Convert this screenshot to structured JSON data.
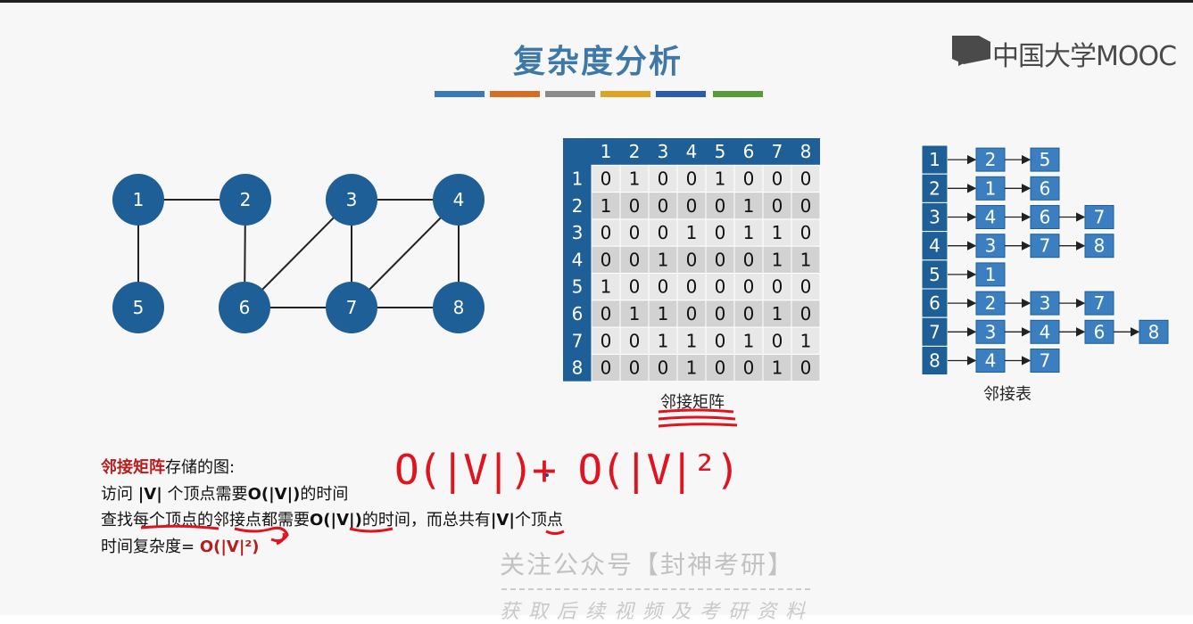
{
  "title": "复杂度分析",
  "logo": {
    "text": "中国大学MOOC"
  },
  "title_bar_colors": [
    "#3e7ab2",
    "#d36f25",
    "#8b8b8b",
    "#dca324",
    "#2e5ba8",
    "#5a9a3d"
  ],
  "graph": {
    "nodes": [
      "1",
      "2",
      "3",
      "4",
      "5",
      "6",
      "7",
      "8"
    ],
    "edges": [
      [
        "1",
        "2"
      ],
      [
        "1",
        "5"
      ],
      [
        "2",
        "6"
      ],
      [
        "3",
        "4"
      ],
      [
        "3",
        "6"
      ],
      [
        "3",
        "7"
      ],
      [
        "4",
        "7"
      ],
      [
        "4",
        "8"
      ],
      [
        "6",
        "7"
      ],
      [
        "7",
        "8"
      ]
    ]
  },
  "matrix": {
    "headers": [
      "1",
      "2",
      "3",
      "4",
      "5",
      "6",
      "7",
      "8"
    ],
    "rows": [
      [
        0,
        1,
        0,
        0,
        1,
        0,
        0,
        0
      ],
      [
        1,
        0,
        0,
        0,
        0,
        1,
        0,
        0
      ],
      [
        0,
        0,
        0,
        1,
        0,
        1,
        1,
        0
      ],
      [
        0,
        0,
        1,
        0,
        0,
        0,
        1,
        1
      ],
      [
        1,
        0,
        0,
        0,
        0,
        0,
        0,
        0
      ],
      [
        0,
        1,
        1,
        0,
        0,
        0,
        1,
        0
      ],
      [
        0,
        0,
        1,
        1,
        0,
        1,
        0,
        1
      ],
      [
        0,
        0,
        0,
        1,
        0,
        0,
        1,
        0
      ]
    ],
    "caption": "邻接矩阵"
  },
  "adjlist": {
    "heads": [
      "1",
      "2",
      "3",
      "4",
      "5",
      "6",
      "7",
      "8"
    ],
    "lists": [
      [
        "2",
        "5"
      ],
      [
        "1",
        "6"
      ],
      [
        "4",
        "6",
        "7"
      ],
      [
        "3",
        "7",
        "8"
      ],
      [
        "1"
      ],
      [
        "2",
        "3",
        "7"
      ],
      [
        "3",
        "4",
        "6",
        "8"
      ],
      [
        "4",
        "7"
      ]
    ],
    "caption": "邻接表"
  },
  "notes": {
    "line1_red": "邻接矩阵",
    "line1_rest": "存储的图:",
    "line2_a": "访问 ",
    "line2_b": "|V|",
    "line2_c": " 个顶点需要",
    "line2_d": "O(|V|)",
    "line2_e": "的时间",
    "line3_a": "查找每个顶点的邻接点都需要",
    "line3_b": "O(|V|)",
    "line3_c": "的时间，而总共有",
    "line3_d": "|V|",
    "line3_e": "个顶点",
    "line4_a": "时间复杂度= ",
    "line4_b": "O(|V|²)"
  },
  "handwriting": "O(|V|)+ O(|V|²)",
  "watermark": {
    "line1": "关注公众号【封神考研】",
    "line2": "获取后续视频及考研资料"
  }
}
